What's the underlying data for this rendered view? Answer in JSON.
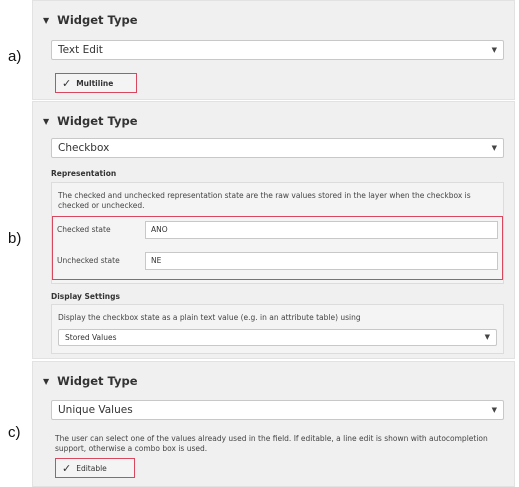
{
  "a": {
    "letter": "a)",
    "header": "Widget Type",
    "combo_value": "Text Edit",
    "checkbox_label": "Multiline"
  },
  "b": {
    "letter": "b)",
    "header": "Widget Type",
    "combo_value": "Checkbox",
    "representation_title": "Representation",
    "representation_desc": "The checked and unchecked representation state are the raw values stored in the layer when the checkbox is checked or unchecked.",
    "checked_label": "Checked state",
    "checked_value": "ANO",
    "unchecked_label": "Unchecked state",
    "unchecked_value": "NE",
    "display_title": "Display Settings",
    "display_desc": "Display the checkbox state as a plain text value (e.g. in an attribute table) using",
    "display_combo": "Stored Values"
  },
  "c": {
    "letter": "c)",
    "header": "Widget Type",
    "combo_value": "Unique Values",
    "desc": "The user can select one of the values already used in the field. If editable, a line edit is shown with autocompletion support, otherwise a combo box is used.",
    "checkbox_label": "Editable"
  },
  "icons": {
    "collapse": "▼",
    "dropdown": "▼",
    "check": "✓"
  }
}
